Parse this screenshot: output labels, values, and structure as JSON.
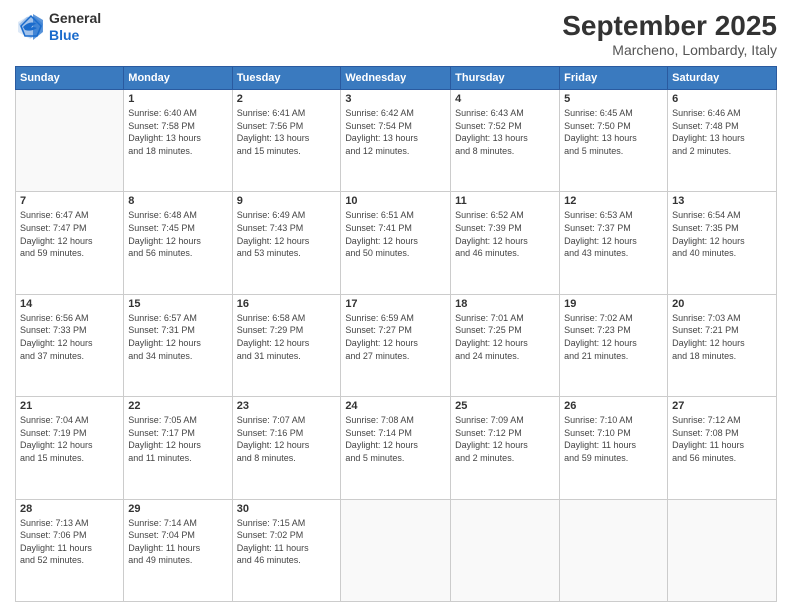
{
  "logo": {
    "general": "General",
    "blue": "Blue"
  },
  "header": {
    "month": "September 2025",
    "location": "Marcheno, Lombardy, Italy"
  },
  "weekdays": [
    "Sunday",
    "Monday",
    "Tuesday",
    "Wednesday",
    "Thursday",
    "Friday",
    "Saturday"
  ],
  "weeks": [
    [
      {
        "day": "",
        "info": ""
      },
      {
        "day": "1",
        "info": "Sunrise: 6:40 AM\nSunset: 7:58 PM\nDaylight: 13 hours\nand 18 minutes."
      },
      {
        "day": "2",
        "info": "Sunrise: 6:41 AM\nSunset: 7:56 PM\nDaylight: 13 hours\nand 15 minutes."
      },
      {
        "day": "3",
        "info": "Sunrise: 6:42 AM\nSunset: 7:54 PM\nDaylight: 13 hours\nand 12 minutes."
      },
      {
        "day": "4",
        "info": "Sunrise: 6:43 AM\nSunset: 7:52 PM\nDaylight: 13 hours\nand 8 minutes."
      },
      {
        "day": "5",
        "info": "Sunrise: 6:45 AM\nSunset: 7:50 PM\nDaylight: 13 hours\nand 5 minutes."
      },
      {
        "day": "6",
        "info": "Sunrise: 6:46 AM\nSunset: 7:48 PM\nDaylight: 13 hours\nand 2 minutes."
      }
    ],
    [
      {
        "day": "7",
        "info": "Sunrise: 6:47 AM\nSunset: 7:47 PM\nDaylight: 12 hours\nand 59 minutes."
      },
      {
        "day": "8",
        "info": "Sunrise: 6:48 AM\nSunset: 7:45 PM\nDaylight: 12 hours\nand 56 minutes."
      },
      {
        "day": "9",
        "info": "Sunrise: 6:49 AM\nSunset: 7:43 PM\nDaylight: 12 hours\nand 53 minutes."
      },
      {
        "day": "10",
        "info": "Sunrise: 6:51 AM\nSunset: 7:41 PM\nDaylight: 12 hours\nand 50 minutes."
      },
      {
        "day": "11",
        "info": "Sunrise: 6:52 AM\nSunset: 7:39 PM\nDaylight: 12 hours\nand 46 minutes."
      },
      {
        "day": "12",
        "info": "Sunrise: 6:53 AM\nSunset: 7:37 PM\nDaylight: 12 hours\nand 43 minutes."
      },
      {
        "day": "13",
        "info": "Sunrise: 6:54 AM\nSunset: 7:35 PM\nDaylight: 12 hours\nand 40 minutes."
      }
    ],
    [
      {
        "day": "14",
        "info": "Sunrise: 6:56 AM\nSunset: 7:33 PM\nDaylight: 12 hours\nand 37 minutes."
      },
      {
        "day": "15",
        "info": "Sunrise: 6:57 AM\nSunset: 7:31 PM\nDaylight: 12 hours\nand 34 minutes."
      },
      {
        "day": "16",
        "info": "Sunrise: 6:58 AM\nSunset: 7:29 PM\nDaylight: 12 hours\nand 31 minutes."
      },
      {
        "day": "17",
        "info": "Sunrise: 6:59 AM\nSunset: 7:27 PM\nDaylight: 12 hours\nand 27 minutes."
      },
      {
        "day": "18",
        "info": "Sunrise: 7:01 AM\nSunset: 7:25 PM\nDaylight: 12 hours\nand 24 minutes."
      },
      {
        "day": "19",
        "info": "Sunrise: 7:02 AM\nSunset: 7:23 PM\nDaylight: 12 hours\nand 21 minutes."
      },
      {
        "day": "20",
        "info": "Sunrise: 7:03 AM\nSunset: 7:21 PM\nDaylight: 12 hours\nand 18 minutes."
      }
    ],
    [
      {
        "day": "21",
        "info": "Sunrise: 7:04 AM\nSunset: 7:19 PM\nDaylight: 12 hours\nand 15 minutes."
      },
      {
        "day": "22",
        "info": "Sunrise: 7:05 AM\nSunset: 7:17 PM\nDaylight: 12 hours\nand 11 minutes."
      },
      {
        "day": "23",
        "info": "Sunrise: 7:07 AM\nSunset: 7:16 PM\nDaylight: 12 hours\nand 8 minutes."
      },
      {
        "day": "24",
        "info": "Sunrise: 7:08 AM\nSunset: 7:14 PM\nDaylight: 12 hours\nand 5 minutes."
      },
      {
        "day": "25",
        "info": "Sunrise: 7:09 AM\nSunset: 7:12 PM\nDaylight: 12 hours\nand 2 minutes."
      },
      {
        "day": "26",
        "info": "Sunrise: 7:10 AM\nSunset: 7:10 PM\nDaylight: 11 hours\nand 59 minutes."
      },
      {
        "day": "27",
        "info": "Sunrise: 7:12 AM\nSunset: 7:08 PM\nDaylight: 11 hours\nand 56 minutes."
      }
    ],
    [
      {
        "day": "28",
        "info": "Sunrise: 7:13 AM\nSunset: 7:06 PM\nDaylight: 11 hours\nand 52 minutes."
      },
      {
        "day": "29",
        "info": "Sunrise: 7:14 AM\nSunset: 7:04 PM\nDaylight: 11 hours\nand 49 minutes."
      },
      {
        "day": "30",
        "info": "Sunrise: 7:15 AM\nSunset: 7:02 PM\nDaylight: 11 hours\nand 46 minutes."
      },
      {
        "day": "",
        "info": ""
      },
      {
        "day": "",
        "info": ""
      },
      {
        "day": "",
        "info": ""
      },
      {
        "day": "",
        "info": ""
      }
    ]
  ]
}
